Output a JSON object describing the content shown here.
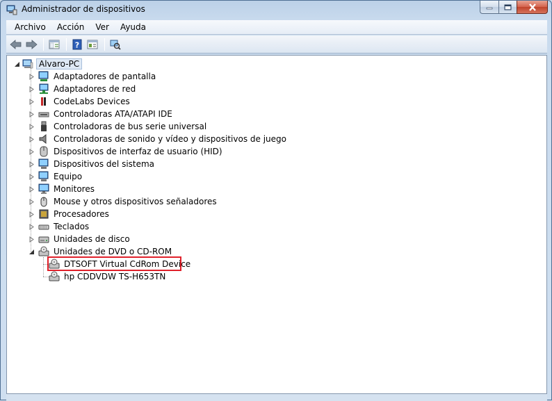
{
  "window": {
    "title": "Administrador de dispositivos"
  },
  "menu": [
    "Archivo",
    "Acción",
    "Ver",
    "Ayuda"
  ],
  "tree": {
    "root": "Alvaro-PC",
    "categories": [
      {
        "label": "Adaptadores de pantalla",
        "icon": "display-adapter-icon"
      },
      {
        "label": "Adaptadores de red",
        "icon": "network-adapter-icon"
      },
      {
        "label": "CodeLabs Devices",
        "icon": "codelabs-device-icon"
      },
      {
        "label": "Controladoras ATA/ATAPI IDE",
        "icon": "ide-controller-icon"
      },
      {
        "label": "Controladoras de bus serie universal",
        "icon": "usb-controller-icon"
      },
      {
        "label": "Controladoras de sonido y vídeo y dispositivos de juego",
        "icon": "sound-controller-icon"
      },
      {
        "label": "Dispositivos de interfaz de usuario (HID)",
        "icon": "hid-device-icon"
      },
      {
        "label": "Dispositivos del sistema",
        "icon": "system-device-icon"
      },
      {
        "label": "Equipo",
        "icon": "computer-icon"
      },
      {
        "label": "Monitores",
        "icon": "monitor-icon"
      },
      {
        "label": "Mouse y otros dispositivos señaladores",
        "icon": "mouse-icon"
      },
      {
        "label": "Procesadores",
        "icon": "processor-icon"
      },
      {
        "label": "Teclados",
        "icon": "keyboard-icon"
      },
      {
        "label": "Unidades de disco",
        "icon": "disk-drive-icon"
      },
      {
        "label": "Unidades de DVD o CD-ROM",
        "icon": "dvd-drive-icon"
      }
    ],
    "dvd_children": [
      {
        "label": "DTSOFT Virtual CdRom Device",
        "highlighted": true
      },
      {
        "label": "hp CDDVDW TS-H653TN",
        "highlighted": false
      }
    ]
  },
  "colors": {
    "highlight_border": "#e0202a",
    "root_selection": "#dfe9f5"
  }
}
